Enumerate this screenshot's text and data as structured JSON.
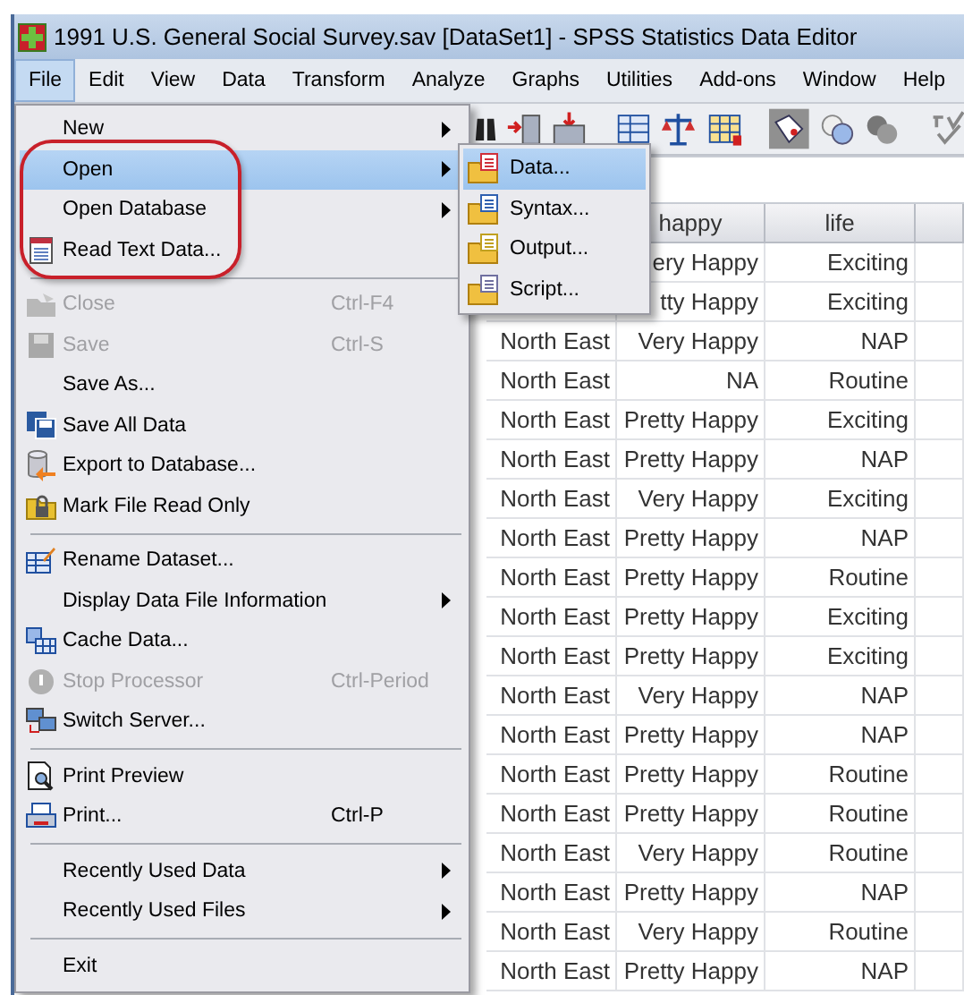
{
  "window": {
    "title": "1991 U.S. General Social Survey.sav [DataSet1] - SPSS Statistics Data Editor"
  },
  "menu_bar": [
    {
      "label": "File",
      "selected": true
    },
    {
      "label": "Edit",
      "selected": false
    },
    {
      "label": "View",
      "selected": false
    },
    {
      "label": "Data",
      "selected": false
    },
    {
      "label": "Transform",
      "selected": false
    },
    {
      "label": "Analyze",
      "selected": false
    },
    {
      "label": "Graphs",
      "selected": false
    },
    {
      "label": "Utilities",
      "selected": false
    },
    {
      "label": "Add-ons",
      "selected": false
    },
    {
      "label": "Window",
      "selected": false
    },
    {
      "label": "Help",
      "selected": false
    }
  ],
  "file_menu": [
    {
      "kind": "item",
      "label": "New",
      "submenu": true,
      "selected": false,
      "disabled": false
    },
    {
      "kind": "item",
      "label": "Open",
      "submenu": true,
      "selected": true,
      "disabled": false
    },
    {
      "kind": "item",
      "label": "Open Database",
      "submenu": true,
      "selected": false,
      "disabled": false
    },
    {
      "kind": "item",
      "label": "Read Text Data...",
      "submenu": false,
      "selected": false,
      "disabled": false
    },
    {
      "kind": "separator"
    },
    {
      "kind": "item",
      "label": "Close",
      "shortcut": "Ctrl-F4",
      "submenu": false,
      "selected": false,
      "disabled": true
    },
    {
      "kind": "item",
      "label": "Save",
      "shortcut": "Ctrl-S",
      "submenu": false,
      "selected": false,
      "disabled": true
    },
    {
      "kind": "item",
      "label": "Save As...",
      "submenu": false,
      "selected": false,
      "disabled": false
    },
    {
      "kind": "item",
      "label": "Save All Data",
      "submenu": false,
      "selected": false,
      "disabled": false
    },
    {
      "kind": "item",
      "label": "Export to Database...",
      "submenu": false,
      "selected": false,
      "disabled": false
    },
    {
      "kind": "item",
      "label": "Mark File Read Only",
      "submenu": false,
      "selected": false,
      "disabled": false
    },
    {
      "kind": "separator"
    },
    {
      "kind": "item",
      "label": "Rename Dataset...",
      "submenu": false,
      "selected": false,
      "disabled": false
    },
    {
      "kind": "item",
      "label": "Display Data File Information",
      "submenu": true,
      "selected": false,
      "disabled": false
    },
    {
      "kind": "item",
      "label": "Cache Data...",
      "submenu": false,
      "selected": false,
      "disabled": false
    },
    {
      "kind": "item",
      "label": "Stop Processor",
      "shortcut": "Ctrl-Period",
      "submenu": false,
      "selected": false,
      "disabled": true
    },
    {
      "kind": "item",
      "label": "Switch Server...",
      "submenu": false,
      "selected": false,
      "disabled": false
    },
    {
      "kind": "separator"
    },
    {
      "kind": "item",
      "label": "Print Preview",
      "submenu": false,
      "selected": false,
      "disabled": false
    },
    {
      "kind": "item",
      "label": "Print...",
      "shortcut": "Ctrl-P",
      "submenu": false,
      "selected": false,
      "disabled": false
    },
    {
      "kind": "separator"
    },
    {
      "kind": "item",
      "label": "Recently Used Data",
      "submenu": true,
      "selected": false,
      "disabled": false
    },
    {
      "kind": "item",
      "label": "Recently Used Files",
      "submenu": true,
      "selected": false,
      "disabled": false
    },
    {
      "kind": "separator"
    },
    {
      "kind": "item",
      "label": "Exit",
      "submenu": false,
      "selected": false,
      "disabled": false
    }
  ],
  "open_submenu": [
    {
      "label": "Data...",
      "selected": true
    },
    {
      "label": "Syntax...",
      "selected": false
    },
    {
      "label": "Output...",
      "selected": false
    },
    {
      "label": "Script...",
      "selected": false
    }
  ],
  "table": {
    "columns": [
      {
        "label": "happy"
      },
      {
        "label": "life"
      }
    ],
    "rows": [
      {
        "happy": "ery Happy",
        "life": "Exciting"
      },
      {
        "happy": "tty Happy",
        "life": "Exciting"
      },
      {
        "column_1": "North East",
        "happy": "Very Happy",
        "life": "NAP"
      },
      {
        "column_1": "North East",
        "happy": "NA",
        "life": "Routine"
      },
      {
        "column_1": "North East",
        "happy": "Pretty Happy",
        "life": "Exciting"
      },
      {
        "column_1": "North East",
        "happy": "Pretty Happy",
        "life": "NAP"
      },
      {
        "column_1": "North East",
        "happy": "Very Happy",
        "life": "Exciting"
      },
      {
        "column_1": "North East",
        "happy": "Pretty Happy",
        "life": "NAP"
      },
      {
        "column_1": "North East",
        "happy": "Pretty Happy",
        "life": "Routine"
      },
      {
        "column_1": "North East",
        "happy": "Pretty Happy",
        "life": "Exciting"
      },
      {
        "column_1": "North East",
        "happy": "Pretty Happy",
        "life": "Exciting"
      },
      {
        "column_1": "North East",
        "happy": "Very Happy",
        "life": "NAP"
      },
      {
        "column_1": "North East",
        "happy": "Pretty Happy",
        "life": "NAP"
      },
      {
        "column_1": "North East",
        "happy": "Pretty Happy",
        "life": "Routine"
      },
      {
        "column_1": "North East",
        "happy": "Pretty Happy",
        "life": "Routine"
      },
      {
        "column_1": "North East",
        "happy": "Very Happy",
        "life": "Routine"
      },
      {
        "column_1": "North East",
        "happy": "Pretty Happy",
        "life": "NAP"
      },
      {
        "column_1": "North East",
        "happy": "Very Happy",
        "life": "Routine"
      },
      {
        "column_1": "North East",
        "happy": "Pretty Happy",
        "life": "NAP"
      }
    ]
  }
}
